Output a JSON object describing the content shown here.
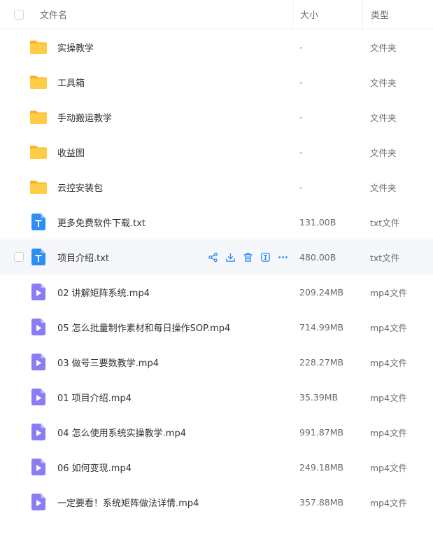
{
  "header": {
    "name_label": "文件名",
    "size_label": "大小",
    "type_label": "类型"
  },
  "colors": {
    "accent": "#2d8cf0",
    "folder": "#ffc53d",
    "video": "#8a7cf5",
    "txt": "#2f8df6"
  },
  "files": [
    {
      "name": "实操教学",
      "size": "-",
      "type": "文件夹",
      "icon": "folder-icon"
    },
    {
      "name": "工具箱",
      "size": "-",
      "type": "文件夹",
      "icon": "folder-icon"
    },
    {
      "name": "手动搬运教学",
      "size": "-",
      "type": "文件夹",
      "icon": "folder-icon"
    },
    {
      "name": "收益图",
      "size": "-",
      "type": "文件夹",
      "icon": "folder-icon"
    },
    {
      "name": "云控安装包",
      "size": "-",
      "type": "文件夹",
      "icon": "folder-icon"
    },
    {
      "name": "更多免费软件下载.txt",
      "size": "131.00B",
      "type": "txt文件",
      "icon": "txt-file-icon"
    },
    {
      "name": "项目介绍.txt",
      "size": "480.00B",
      "type": "txt文件",
      "icon": "txt-file-icon"
    },
    {
      "name": "02 讲解矩阵系统.mp4",
      "size": "209.24MB",
      "type": "mp4文件",
      "icon": "video-file-icon"
    },
    {
      "name": "05 怎么批量制作素材和每日操作SOP.mp4",
      "size": "714.99MB",
      "type": "mp4文件",
      "icon": "video-file-icon"
    },
    {
      "name": "03 做号三要数教学.mp4",
      "size": "228.27MB",
      "type": "mp4文件",
      "icon": "video-file-icon"
    },
    {
      "name": "01 项目介绍.mp4",
      "size": "35.39MB",
      "type": "mp4文件",
      "icon": "video-file-icon"
    },
    {
      "name": "04 怎么使用系统实操教学.mp4",
      "size": "991.87MB",
      "type": "mp4文件",
      "icon": "video-file-icon"
    },
    {
      "name": "06 如何变现.mp4",
      "size": "249.18MB",
      "type": "mp4文件",
      "icon": "video-file-icon"
    },
    {
      "name": "一定要看！系统矩阵做法详情.mp4",
      "size": "357.88MB",
      "type": "mp4文件",
      "icon": "video-file-icon"
    }
  ],
  "hovered_index": 6,
  "hover_actions": [
    "share-icon",
    "download-icon",
    "delete-icon",
    "rename-icon",
    "more-icon"
  ]
}
